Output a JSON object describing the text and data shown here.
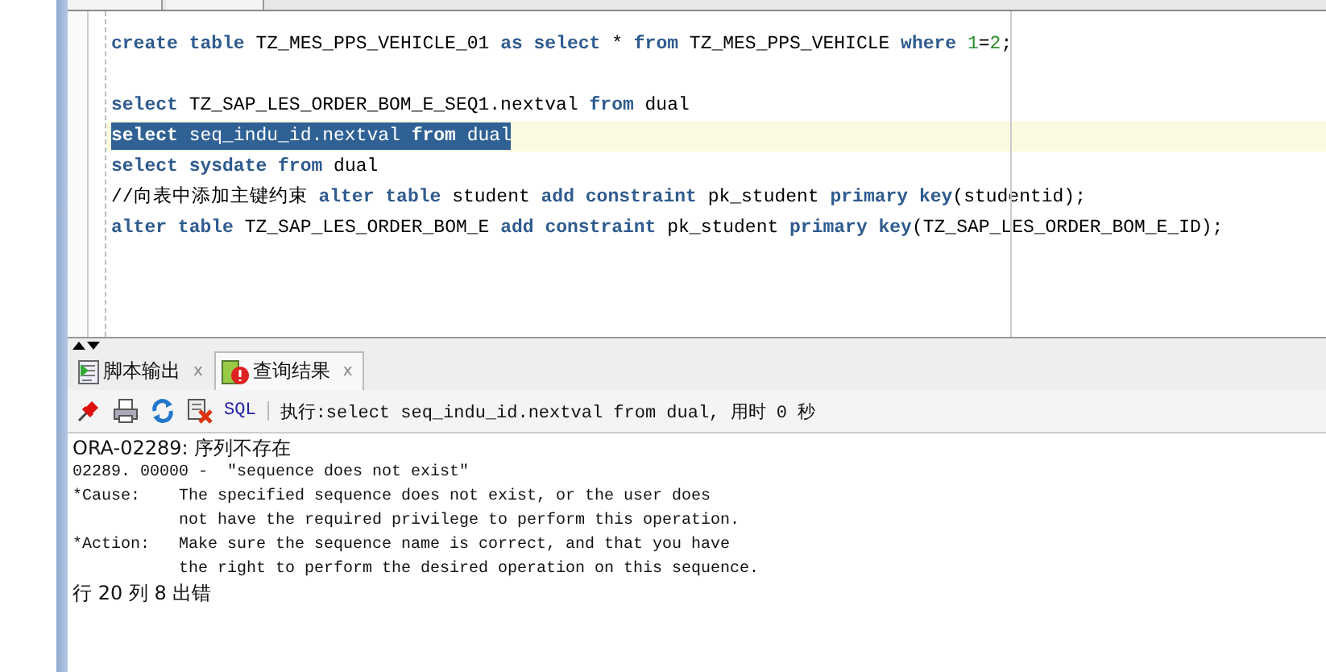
{
  "editor": {
    "lines": [
      {
        "kind": "code",
        "current": false,
        "selected": false,
        "tokens": [
          {
            "t": "create ",
            "kind": "keyword"
          },
          {
            "t": "table ",
            "kind": "keyword"
          },
          {
            "t": "TZ_MES_PPS_VEHICLE_01 ",
            "kind": "plain"
          },
          {
            "t": "as ",
            "kind": "keyword"
          },
          {
            "t": "select ",
            "kind": "keyword"
          },
          {
            "t": "* ",
            "kind": "plain"
          },
          {
            "t": "from ",
            "kind": "keyword"
          },
          {
            "t": "TZ_MES_PPS_VEHICLE ",
            "kind": "plain"
          },
          {
            "t": "where ",
            "kind": "keyword"
          },
          {
            "t": "1",
            "kind": "number"
          },
          {
            "t": "=",
            "kind": "plain"
          },
          {
            "t": "2",
            "kind": "number"
          },
          {
            "t": ";",
            "kind": "plain"
          }
        ]
      },
      {
        "kind": "blank"
      },
      {
        "kind": "code",
        "current": false,
        "selected": false,
        "tokens": [
          {
            "t": "select ",
            "kind": "keyword"
          },
          {
            "t": "TZ_SAP_LES_ORDER_BOM_E_SEQ1.nextval ",
            "kind": "plain"
          },
          {
            "t": "from ",
            "kind": "keyword"
          },
          {
            "t": "dual",
            "kind": "plain"
          }
        ]
      },
      {
        "kind": "code",
        "current": true,
        "selected": true,
        "tokens": [
          {
            "t": "select ",
            "kind": "keyword"
          },
          {
            "t": "seq_indu_id.nextval ",
            "kind": "plain"
          },
          {
            "t": "from ",
            "kind": "keyword"
          },
          {
            "t": "dual",
            "kind": "plain"
          }
        ]
      },
      {
        "kind": "code",
        "current": false,
        "selected": false,
        "tokens": [
          {
            "t": "select ",
            "kind": "keyword"
          },
          {
            "t": "sysdate ",
            "kind": "keyword"
          },
          {
            "t": "from ",
            "kind": "keyword"
          },
          {
            "t": "dual",
            "kind": "plain"
          }
        ]
      },
      {
        "kind": "code",
        "current": false,
        "selected": false,
        "tokens": [
          {
            "t": "//向表中添加主键约束 ",
            "kind": "plain"
          },
          {
            "t": "alter ",
            "kind": "keyword"
          },
          {
            "t": "table ",
            "kind": "keyword"
          },
          {
            "t": "student ",
            "kind": "plain"
          },
          {
            "t": "add ",
            "kind": "keyword"
          },
          {
            "t": "constraint ",
            "kind": "keyword"
          },
          {
            "t": "pk_student ",
            "kind": "plain"
          },
          {
            "t": "primary ",
            "kind": "keyword"
          },
          {
            "t": "key",
            "kind": "keyword"
          },
          {
            "t": "(studentid);",
            "kind": "plain"
          }
        ]
      },
      {
        "kind": "code",
        "current": false,
        "selected": false,
        "tokens": [
          {
            "t": "alter ",
            "kind": "keyword"
          },
          {
            "t": "table ",
            "kind": "keyword"
          },
          {
            "t": "TZ_SAP_LES_ORDER_BOM_E ",
            "kind": "plain"
          },
          {
            "t": "add ",
            "kind": "keyword"
          },
          {
            "t": "constraint ",
            "kind": "keyword"
          },
          {
            "t": "pk_student ",
            "kind": "plain"
          },
          {
            "t": "primary ",
            "kind": "keyword"
          },
          {
            "t": "key",
            "kind": "keyword"
          },
          {
            "t": "(TZ_SAP_LES_ORDER_BOM_E_ID);",
            "kind": "plain"
          }
        ]
      }
    ]
  },
  "output_tabs": [
    {
      "label": "脚本输出",
      "close": "x",
      "kind": "script",
      "selected": false
    },
    {
      "label": "查询结果",
      "close": "x",
      "kind": "query-error",
      "selected": true
    }
  ],
  "toolbar": {
    "sql_label": "SQL",
    "status": "执行:select seq_indu_id.nextval from dual, 用时 0 秒"
  },
  "output": {
    "heading": "ORA-02289: 序列不存在",
    "code_line": "02289. 00000 -  \"sequence does not exist\"",
    "sections": [
      {
        "label": "*Cause:",
        "lines": [
          "The specified sequence does not exist, or the user does",
          "not have the required privilege to perform this operation."
        ]
      },
      {
        "label": "*Action:",
        "lines": [
          "Make sure the sequence name is correct, and that you have",
          "the right to perform the desired operation on this sequence."
        ]
      }
    ],
    "footer": "行 20 列 8 出错"
  }
}
